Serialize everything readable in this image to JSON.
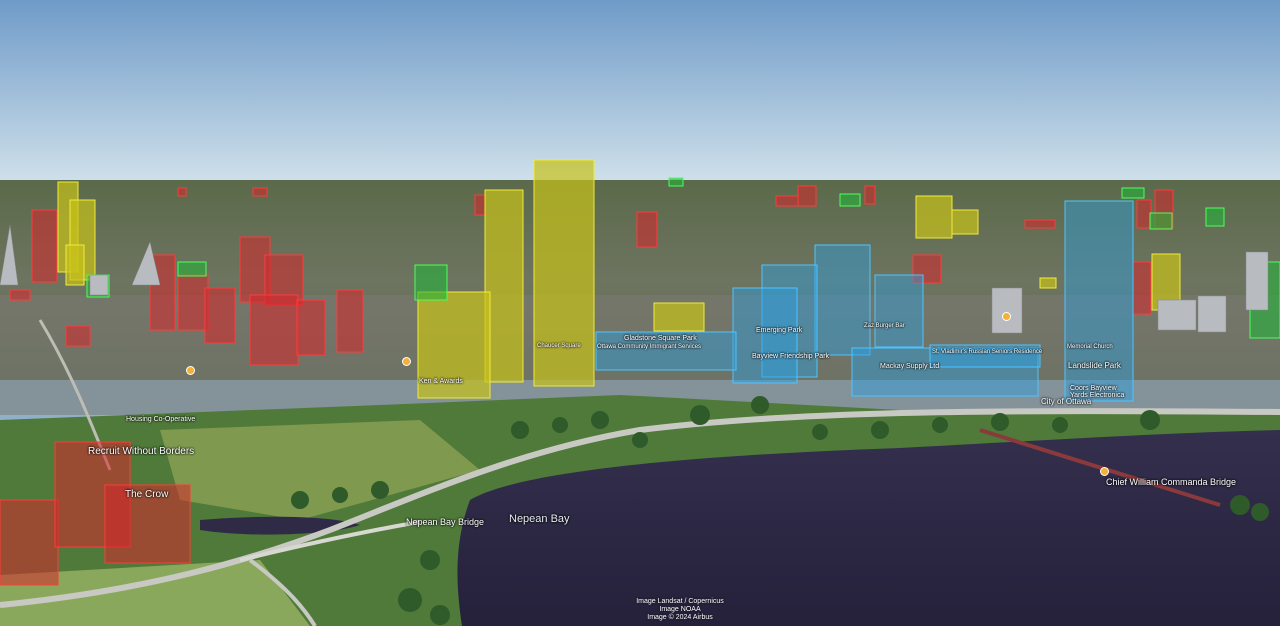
{
  "colors": {
    "red_block": "#d7262b",
    "yellow_block": "#c8c21a",
    "green_block": "#25b33a",
    "blue_block": "#2d9fe0",
    "water": "#2b2744",
    "sky_top": "#7fa6d0",
    "sky_bottom": "#c9dbe8"
  },
  "labels": {
    "recruit": "Recruit Without Borders",
    "crow": "The Crow",
    "nepean_bay_bridge": "Nepean Bay Bridge",
    "nepean_bay": "Nepean Bay",
    "commanda_bridge": "Chief William Commanda Bridge",
    "city_of_ottawa": "City of Ottawa",
    "lansdowne": "Landslide Park",
    "cobra": "Coors Bayview Yards Electronica",
    "mackay": "Mackay Supply Ltd",
    "bayview_friendship": "Bayview Friendship Park",
    "gladstone": "Gladstone Square Park",
    "ottawa_immigrant": "Ottawa Community Immigrant Services",
    "emerging": "Emerging Park",
    "zaz": "Zaz Burger Bar",
    "st_vladimir": "St. Vladimir's Russian Seniors Residence",
    "memorial": "Memorial Church",
    "housing_coop": "Housing Co-Operative",
    "chaucer": "Chaucer Square",
    "ken_awards": "Ken & Awards"
  },
  "credits": {
    "line1": "Image Landsat / Copernicus",
    "line2": "Image NOAA",
    "line3": "Image © 2024 Airbus"
  }
}
